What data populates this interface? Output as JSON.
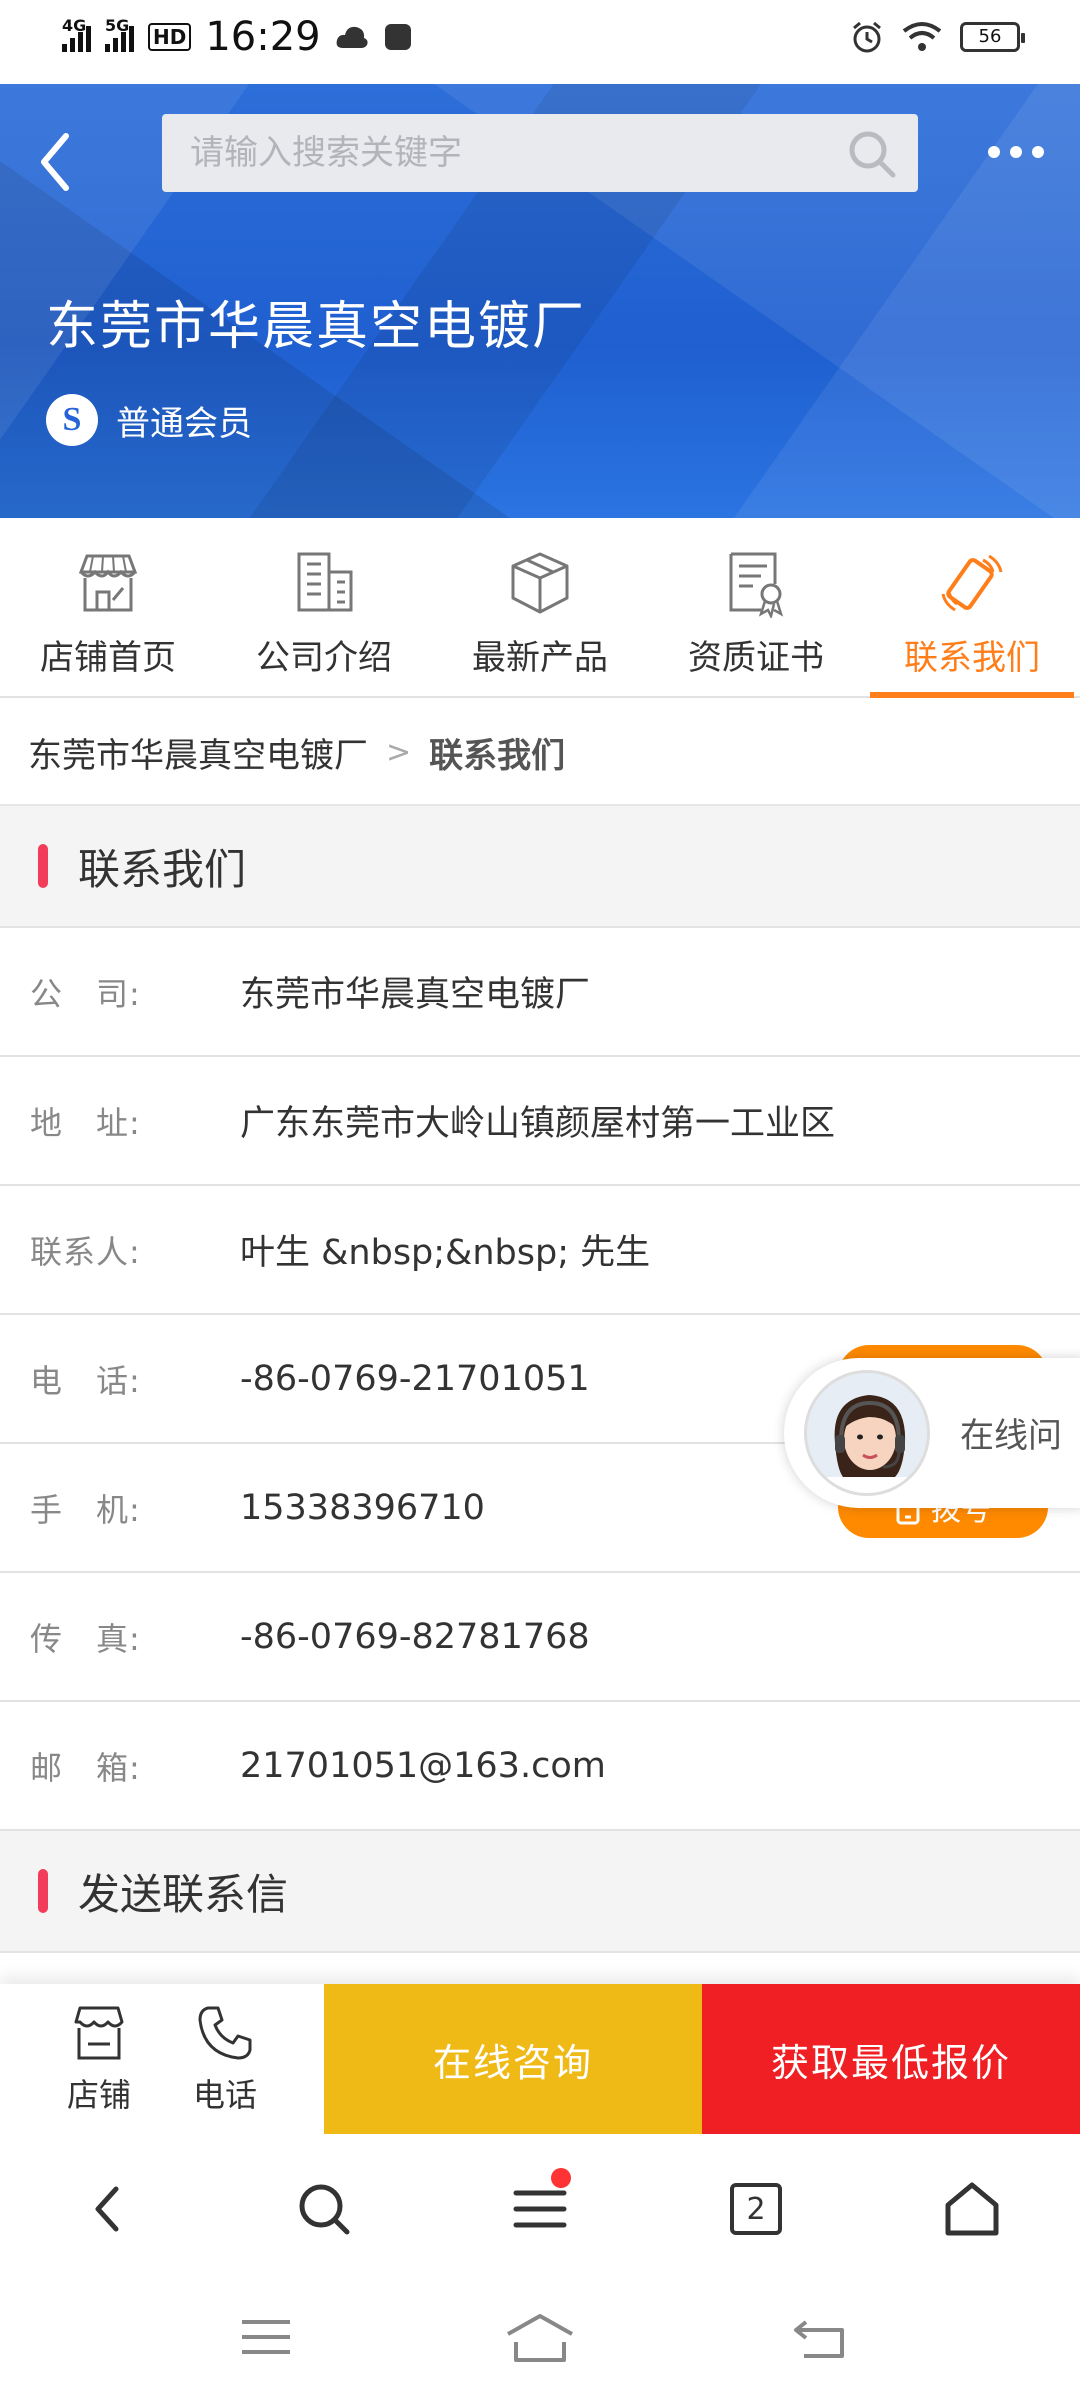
{
  "status_bar": {
    "net1": "4G",
    "net2": "5G",
    "hd": "HD",
    "time": "16:29",
    "battery": "56"
  },
  "header": {
    "search_placeholder": "请输入搜索关键字",
    "company_name": "东莞市华晨真空电镀厂",
    "member_badge": "S",
    "member_level": "普通会员"
  },
  "tabs": [
    {
      "label": "店铺首页",
      "icon": "store-icon"
    },
    {
      "label": "公司介绍",
      "icon": "building-icon"
    },
    {
      "label": "最新产品",
      "icon": "box-icon"
    },
    {
      "label": "资质证书",
      "icon": "certificate-icon"
    },
    {
      "label": "联系我们",
      "icon": "phone-ringing-icon",
      "active": true
    }
  ],
  "breadcrumb": {
    "home": "东莞市华晨真空电镀厂",
    "separator": ">",
    "current": "联系我们"
  },
  "contact_section": {
    "title": "联系我们",
    "rows": [
      {
        "label": "公　司:",
        "value": "东莞市华晨真空电镀厂"
      },
      {
        "label": "地　址:",
        "value": "广东东莞市大岭山镇颜屋村第一工业区"
      },
      {
        "label": "联系人:",
        "value": "叶生 &nbsp;&nbsp; 先生"
      },
      {
        "label": "电　话:",
        "value": "-86-0769-21701051"
      },
      {
        "label": "手　机:",
        "value": "15338396710"
      },
      {
        "label": "传　真:",
        "value": "-86-0769-82781768"
      },
      {
        "label": "邮　箱:",
        "value": "21701051@163.com"
      }
    ],
    "dial_label": "拨号"
  },
  "send_section": {
    "title": "发送联系信"
  },
  "chat_float": {
    "label": "在线问"
  },
  "bottom_bar": {
    "store_label": "店铺",
    "phone_label": "电话",
    "consult_label": "在线咨询",
    "quote_label": "获取最低报价"
  },
  "browser_nav": {
    "tab_count": "2"
  },
  "colors": {
    "accent_orange": "#ff7e1a",
    "section_bar": "#f23d5a",
    "consult_yellow": "#efba16",
    "quote_red": "#ef1f23",
    "banner_blue": "#2563d6"
  }
}
